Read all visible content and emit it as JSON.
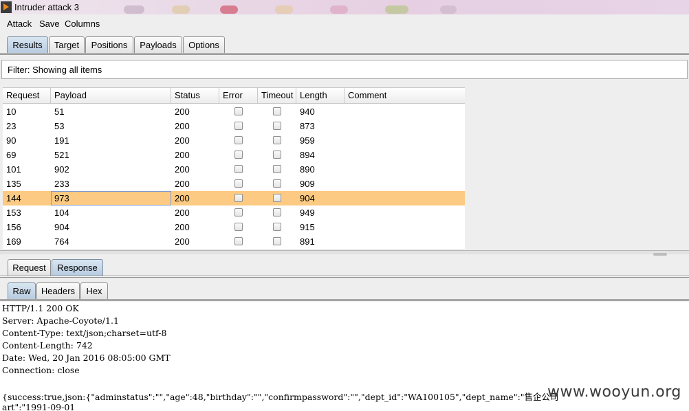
{
  "window": {
    "title": "Intruder attack 3"
  },
  "menu": [
    "Attack",
    "Save",
    "Columns"
  ],
  "main_tabs": [
    "Results",
    "Target",
    "Positions",
    "Payloads",
    "Options"
  ],
  "filter": {
    "text": "Filter: Showing all items"
  },
  "table": {
    "columns": [
      "Request",
      "Payload",
      "Status",
      "Error",
      "Timeout",
      "Length",
      "Comment"
    ],
    "rows": [
      {
        "request": "10",
        "payload": "51",
        "status": "200",
        "error": false,
        "timeout": false,
        "length": "940",
        "comment": ""
      },
      {
        "request": "23",
        "payload": "53",
        "status": "200",
        "error": false,
        "timeout": false,
        "length": "873",
        "comment": ""
      },
      {
        "request": "90",
        "payload": "191",
        "status": "200",
        "error": false,
        "timeout": false,
        "length": "959",
        "comment": ""
      },
      {
        "request": "69",
        "payload": "521",
        "status": "200",
        "error": false,
        "timeout": false,
        "length": "894",
        "comment": ""
      },
      {
        "request": "101",
        "payload": "902",
        "status": "200",
        "error": false,
        "timeout": false,
        "length": "890",
        "comment": ""
      },
      {
        "request": "135",
        "payload": "233",
        "status": "200",
        "error": false,
        "timeout": false,
        "length": "909",
        "comment": ""
      },
      {
        "request": "144",
        "payload": "973",
        "status": "200",
        "error": false,
        "timeout": false,
        "length": "904",
        "comment": "",
        "selected": true
      },
      {
        "request": "153",
        "payload": "104",
        "status": "200",
        "error": false,
        "timeout": false,
        "length": "949",
        "comment": ""
      },
      {
        "request": "156",
        "payload": "904",
        "status": "200",
        "error": false,
        "timeout": false,
        "length": "915",
        "comment": ""
      },
      {
        "request": "169",
        "payload": "764",
        "status": "200",
        "error": false,
        "timeout": false,
        "length": "891",
        "comment": ""
      }
    ]
  },
  "detail_tabs": [
    "Request",
    "Response"
  ],
  "view_tabs": [
    "Raw",
    "Headers",
    "Hex"
  ],
  "response": {
    "lines": [
      "HTTP/1.1 200 OK",
      "Server: Apache-Coyote/1.1",
      "Content-Type: text/json;charset=utf-8",
      "Content-Length: 742",
      "Date: Wed, 20 Jan 2016 08:05:00 GMT",
      "Connection: close",
      "",
      "{success:true,json:{\"adminstatus\":\"\",\"age\":48,\"birthday\":\"\",\"confirmpassword\":\"\",\"dept_id\":\"WA100105\",\"dept_name\":\"售企公司",
      "art\":\"1991-09-01"
    ]
  },
  "watermark": "www.wooyun.org",
  "colors": {
    "selected_row": "#fcca82",
    "active_tab": "#c6d7e8"
  }
}
